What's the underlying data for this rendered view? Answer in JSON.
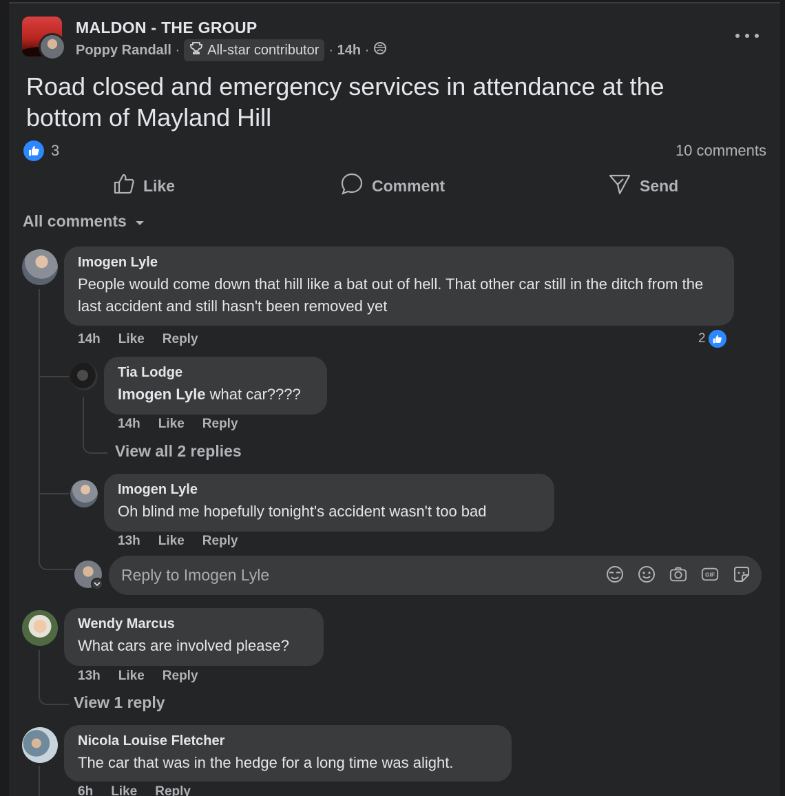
{
  "post": {
    "group_name": "MALDON - THE GROUP",
    "poster": "Poppy Randall",
    "badge": "All-star contributor",
    "time": "14h",
    "text": "Road closed and emergency services in attendance at the bottom of Mayland Hill",
    "reaction_count": "3",
    "comments_count": "10 comments"
  },
  "actions": {
    "like": "Like",
    "comment": "Comment",
    "send": "Send"
  },
  "filter_label": "All comments",
  "comments": [
    {
      "author": "Imogen Lyle",
      "text": "People would come down that hill like a bat out of hell. That other car still in the ditch from the last accident and still hasn't been removed yet",
      "time": "14h",
      "like": "Like",
      "reply": "Reply",
      "reactions": "2",
      "replies": [
        {
          "author": "Tia Lodge",
          "mention": "Imogen Lyle",
          "text": " what car????",
          "time": "14h",
          "like": "Like",
          "reply": "Reply",
          "view_replies": "View all 2 replies"
        },
        {
          "author": "Imogen Lyle",
          "text": "Oh blind me hopefully tonight's accident wasn't too bad",
          "time": "13h",
          "like": "Like",
          "reply": "Reply"
        }
      ],
      "reply_placeholder": "Reply to Imogen Lyle"
    },
    {
      "author": "Wendy Marcus",
      "text": "What cars are involved please?",
      "time": "13h",
      "like": "Like",
      "reply": "Reply",
      "view_replies": "View 1 reply"
    },
    {
      "author": "Nicola Louise Fletcher",
      "text": "The car that was in the hedge for a long time was alight.",
      "time": "6h",
      "like": "Like",
      "reply": "Reply"
    }
  ],
  "icons": {
    "more": "more-dots-icon",
    "trophy": "trophy-icon",
    "globe": "globe-icon",
    "like": "thumbs-up-icon",
    "comment": "comment-icon",
    "send": "send-icon",
    "dropdown": "chevron-down-icon",
    "avatar_emoji": "avatar-emoji-icon",
    "emoji": "emoji-icon",
    "camera": "camera-icon",
    "gif": "gif-icon",
    "sticker": "sticker-icon"
  },
  "colors": {
    "background": "#242526",
    "bubble": "#3a3b3c",
    "accent": "#2d88ff",
    "text": "#e4e6eb",
    "muted": "#b0b3b8"
  }
}
